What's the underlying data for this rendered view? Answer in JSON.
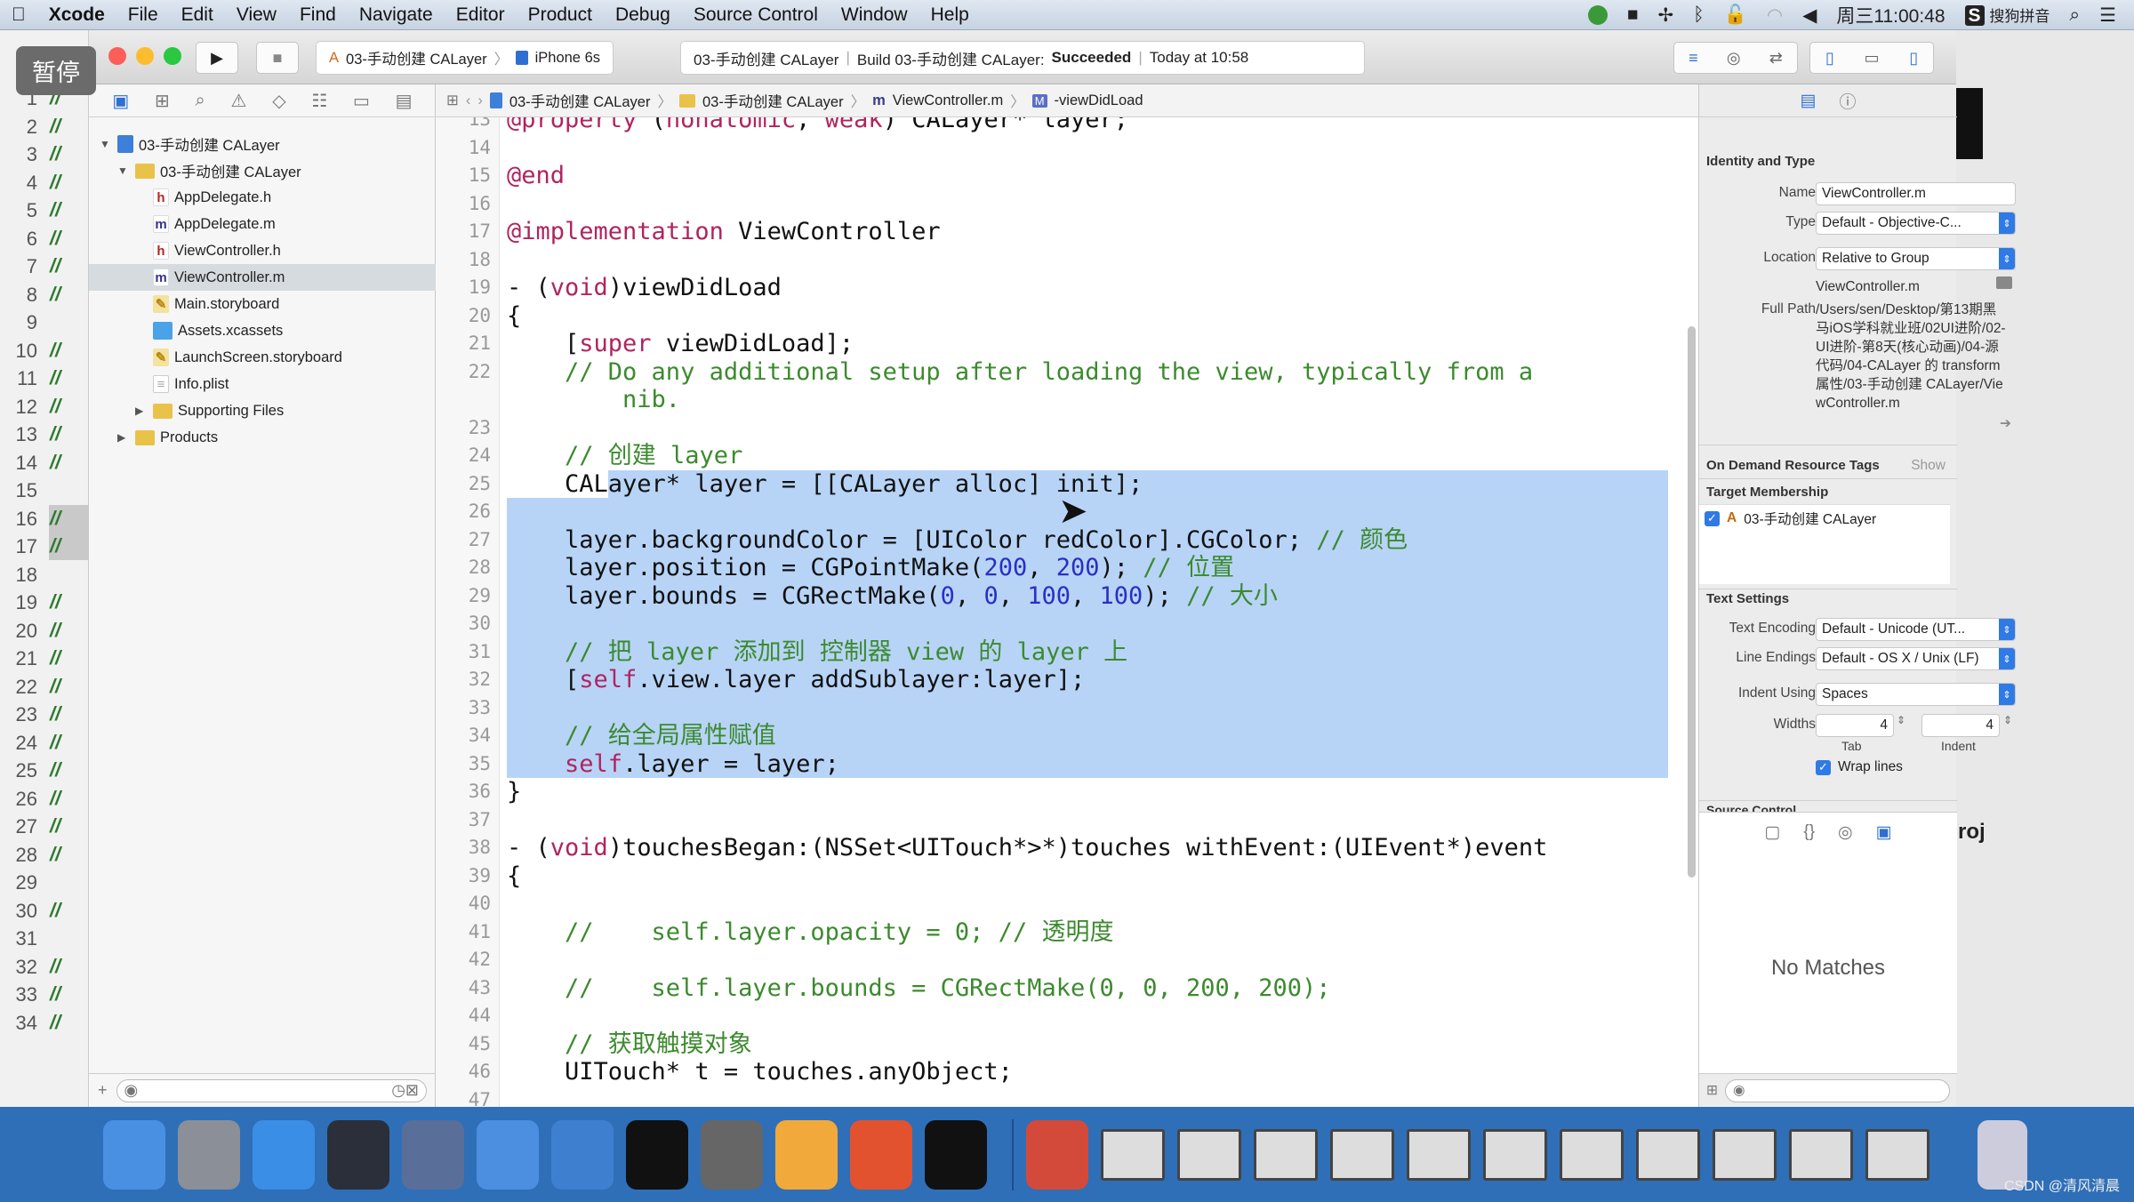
{
  "menubar": {
    "app": "Xcode",
    "items": [
      "File",
      "Edit",
      "View",
      "Find",
      "Navigate",
      "Editor",
      "Product",
      "Debug",
      "Source Control",
      "Window",
      "Help"
    ],
    "clock": "周三11:00:48",
    "ime": "搜狗拼音"
  },
  "overlay": {
    "pause": "暂停"
  },
  "background_gutter": [
    {
      "n": "1",
      "s": "//"
    },
    {
      "n": "2",
      "s": "//"
    },
    {
      "n": "3",
      "s": "//"
    },
    {
      "n": "4",
      "s": "//"
    },
    {
      "n": "5",
      "s": "//"
    },
    {
      "n": "6",
      "s": "//"
    },
    {
      "n": "7",
      "s": "//"
    },
    {
      "n": "8",
      "s": "//"
    },
    {
      "n": "9",
      "s": ""
    },
    {
      "n": "10",
      "s": "//"
    },
    {
      "n": "11",
      "s": "//"
    },
    {
      "n": "12",
      "s": "//"
    },
    {
      "n": "13",
      "s": "//"
    },
    {
      "n": "14",
      "s": "//"
    },
    {
      "n": "15",
      "s": ""
    },
    {
      "n": "16",
      "s": "//",
      "hl": true
    },
    {
      "n": "17",
      "s": "//",
      "hl": true
    },
    {
      "n": "18",
      "s": ""
    },
    {
      "n": "19",
      "s": "//"
    },
    {
      "n": "20",
      "s": "//"
    },
    {
      "n": "21",
      "s": "//"
    },
    {
      "n": "22",
      "s": "//"
    },
    {
      "n": "23",
      "s": "//"
    },
    {
      "n": "24",
      "s": "//"
    },
    {
      "n": "25",
      "s": "//"
    },
    {
      "n": "26",
      "s": "//"
    },
    {
      "n": "27",
      "s": "//"
    },
    {
      "n": "28",
      "s": "//"
    },
    {
      "n": "29",
      "s": ""
    },
    {
      "n": "30",
      "s": "//"
    },
    {
      "n": "31",
      "s": ""
    },
    {
      "n": "32",
      "s": "//"
    },
    {
      "n": "33",
      "s": "//"
    },
    {
      "n": "34",
      "s": "//"
    }
  ],
  "toolbar": {
    "scheme": "03-手动创建 CALayer",
    "device": "iPhone 6s",
    "status_project": "03-手动创建 CALayer",
    "status_build": "Build 03-手动创建 CALayer:",
    "status_result": "Succeeded",
    "status_time": "Today at 10:58"
  },
  "navigator": {
    "tree": [
      {
        "label": "03-手动创建 CALayer",
        "level": 0,
        "icon": "project",
        "open": true
      },
      {
        "label": "03-手动创建 CALayer",
        "level": 1,
        "icon": "folder",
        "open": true
      },
      {
        "label": "AppDelegate.h",
        "level": 2,
        "icon": "h"
      },
      {
        "label": "AppDelegate.m",
        "level": 2,
        "icon": "m"
      },
      {
        "label": "ViewController.h",
        "level": 2,
        "icon": "h"
      },
      {
        "label": "ViewController.m",
        "level": 2,
        "icon": "m",
        "selected": true
      },
      {
        "label": "Main.storyboard",
        "level": 2,
        "icon": "storyboard"
      },
      {
        "label": "Assets.xcassets",
        "level": 2,
        "icon": "assets"
      },
      {
        "label": "LaunchScreen.storyboard",
        "level": 2,
        "icon": "storyboard"
      },
      {
        "label": "Info.plist",
        "level": 2,
        "icon": "plist"
      },
      {
        "label": "Supporting Files",
        "level": 2,
        "icon": "folder",
        "open": false
      },
      {
        "label": "Products",
        "level": 1,
        "icon": "folder",
        "open": false
      }
    ]
  },
  "jumpbar": [
    "03-手动创建 CALayer",
    "03-手动创建 CALayer",
    "ViewController.m",
    "-viewDidLoad"
  ],
  "code": [
    {
      "n": "13",
      "segs": [
        [
          "@property",
          "kw"
        ],
        [
          " (",
          ""
        ],
        [
          "nonatomic",
          "kw"
        ],
        [
          ", ",
          ""
        ],
        [
          "weak",
          "kw"
        ],
        [
          ") CALayer* layer;",
          ""
        ]
      ]
    },
    {
      "n": "14",
      "segs": []
    },
    {
      "n": "15",
      "segs": [
        [
          "@end",
          "kw"
        ]
      ]
    },
    {
      "n": "16",
      "segs": []
    },
    {
      "n": "17",
      "segs": [
        [
          "@implementation",
          "kw"
        ],
        [
          " ViewController",
          ""
        ]
      ]
    },
    {
      "n": "18",
      "segs": []
    },
    {
      "n": "19",
      "segs": [
        [
          "- (",
          ""
        ],
        [
          "void",
          "kw"
        ],
        [
          ")viewDidLoad",
          ""
        ]
      ]
    },
    {
      "n": "20",
      "segs": [
        [
          "{",
          ""
        ]
      ]
    },
    {
      "n": "21",
      "segs": [
        [
          "    [",
          ""
        ],
        [
          "super",
          "kw"
        ],
        [
          " viewDidLoad];",
          ""
        ]
      ]
    },
    {
      "n": "22",
      "segs": [
        [
          "    // Do any additional setup after loading the view, typically from a",
          "cm"
        ]
      ]
    },
    {
      "n": "",
      "segs": [
        [
          "        nib.",
          "cm"
        ]
      ]
    },
    {
      "n": "23",
      "segs": []
    },
    {
      "n": "24",
      "segs": [
        [
          "    // 创建 layer",
          "cm"
        ]
      ]
    },
    {
      "n": "25",
      "segs": [
        [
          "    CALayer* layer = [[CALayer alloc] init];",
          ""
        ]
      ]
    },
    {
      "n": "26",
      "segs": []
    },
    {
      "n": "27",
      "segs": [
        [
          "    layer.backgroundColor = [UIColor redColor].CGColor; ",
          ""
        ],
        [
          "// 颜色",
          "cm"
        ]
      ]
    },
    {
      "n": "28",
      "segs": [
        [
          "    layer.position = CGPointMake(",
          ""
        ],
        [
          "200",
          "nm"
        ],
        [
          ", ",
          ""
        ],
        [
          "200",
          "nm"
        ],
        [
          "); ",
          ""
        ],
        [
          "// 位置",
          "cm"
        ]
      ]
    },
    {
      "n": "29",
      "segs": [
        [
          "    layer.bounds = CGRectMake(",
          ""
        ],
        [
          "0",
          "nm"
        ],
        [
          ", ",
          ""
        ],
        [
          "0",
          "nm"
        ],
        [
          ", ",
          ""
        ],
        [
          "100",
          "nm"
        ],
        [
          ", ",
          ""
        ],
        [
          "100",
          "nm"
        ],
        [
          "); ",
          ""
        ],
        [
          "// 大小",
          "cm"
        ]
      ]
    },
    {
      "n": "30",
      "segs": []
    },
    {
      "n": "31",
      "segs": [
        [
          "    // 把 layer 添加到 控制器 view 的 layer 上",
          "cm"
        ]
      ]
    },
    {
      "n": "32",
      "segs": [
        [
          "    [",
          ""
        ],
        [
          "self",
          "kw"
        ],
        [
          ".view.layer addSublayer:layer];",
          ""
        ]
      ]
    },
    {
      "n": "33",
      "segs": []
    },
    {
      "n": "34",
      "segs": [
        [
          "    // 给全局属性赋值",
          "cm"
        ]
      ]
    },
    {
      "n": "35",
      "segs": [
        [
          "    ",
          ""
        ],
        [
          "self",
          "kw"
        ],
        [
          ".layer = layer;",
          ""
        ]
      ]
    },
    {
      "n": "36",
      "segs": [
        [
          "}",
          ""
        ]
      ]
    },
    {
      "n": "37",
      "segs": []
    },
    {
      "n": "38",
      "segs": [
        [
          "- (",
          ""
        ],
        [
          "void",
          "kw"
        ],
        [
          ")touchesBegan:(NSSet<UITouch*>*)touches withEvent:(UIEvent*)event",
          ""
        ]
      ]
    },
    {
      "n": "39",
      "segs": [
        [
          "{",
          ""
        ]
      ]
    },
    {
      "n": "40",
      "segs": []
    },
    {
      "n": "41",
      "segs": [
        [
          "    //    self.layer.opacity = 0; // 透明度",
          "cm"
        ]
      ]
    },
    {
      "n": "42",
      "segs": []
    },
    {
      "n": "43",
      "segs": [
        [
          "    //    self.layer.bounds = CGRectMake(0, 0, 200, 200);",
          "cm"
        ]
      ]
    },
    {
      "n": "44",
      "segs": []
    },
    {
      "n": "45",
      "segs": [
        [
          "    // 获取触摸对象",
          "cm"
        ]
      ]
    },
    {
      "n": "46",
      "segs": [
        [
          "    UITouch* t = touches.anyObject;",
          ""
        ]
      ]
    },
    {
      "n": "47",
      "segs": []
    }
  ],
  "inspector": {
    "identity_title": "Identity and Type",
    "name_label": "Name",
    "name_value": "ViewController.m",
    "type_label": "Type",
    "type_value": "Default - Objective-C...",
    "location_label": "Location",
    "location_value": "Relative to Group",
    "location_file": "ViewController.m",
    "fullpath_label": "Full Path",
    "fullpath_value": "/Users/sen/Desktop/第13期黑马iOS学科就业班/02UI进阶/02-UI进阶-第8天(核心动画)/04-源代码/04-CALayer 的 transform 属性/03-手动创建 CALayer/ViewController.m",
    "odr_title": "On Demand Resource Tags",
    "odr_show": "Show",
    "target_title": "Target Membership",
    "target_item": "03-手动创建 CALayer",
    "text_title": "Text Settings",
    "encoding_label": "Text Encoding",
    "encoding_value": "Default - Unicode (UT...",
    "endings_label": "Line Endings",
    "endings_value": "Default - OS X / Unix (LF)",
    "indent_label": "Indent Using",
    "indent_value": "Spaces",
    "widths_label": "Widths",
    "tab_value": "4",
    "indent_width_value": "4",
    "tab_caption": "Tab",
    "indent_caption": "Indent",
    "wrap_label": "Wrap lines",
    "wrap_checked": true,
    "source_control_title": "Source Control",
    "library_empty": "No Matches"
  },
  "right_background": {
    "fragment": "roj"
  },
  "dock": [
    "Finder",
    "Launchpad",
    "Safari",
    "Mouse",
    "Photo Slideshow",
    "Xcode",
    "Instruments",
    "Terminal",
    "System Preferences",
    "Sketch",
    "P App",
    "Console",
    "QuickTime"
  ],
  "watermark": "CSDN @清风清晨"
}
